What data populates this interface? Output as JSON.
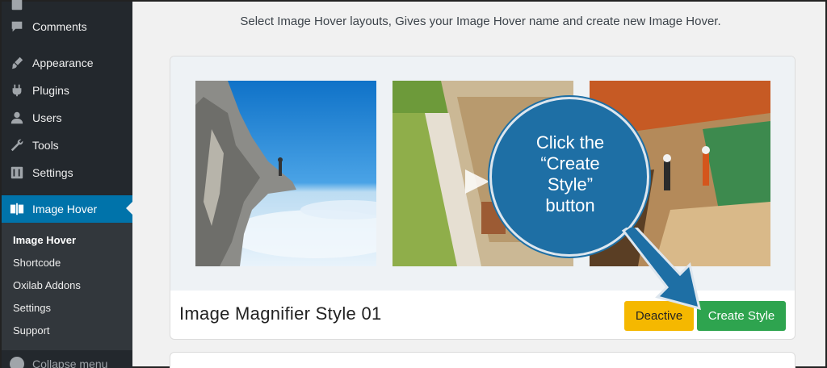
{
  "sidebar": {
    "items": [
      {
        "label": "Comments",
        "icon": "comment-icon"
      },
      {
        "label": "Appearance",
        "icon": "brush-icon"
      },
      {
        "label": "Plugins",
        "icon": "plug-icon"
      },
      {
        "label": "Users",
        "icon": "users-icon"
      },
      {
        "label": "Tools",
        "icon": "wrench-icon"
      },
      {
        "label": "Settings",
        "icon": "settings-icon"
      }
    ],
    "active": {
      "label": "Image Hover",
      "icon": "image-hover-icon"
    },
    "submenu": [
      "Image Hover",
      "Shortcode",
      "Oxilab Addons",
      "Settings",
      "Support"
    ],
    "collapse_label": "Collapse menu"
  },
  "main": {
    "intro": "Select Image Hover layouts, Gives your Image Hover name and create new Image Hover.",
    "style_card": {
      "title": "Image Magnifier Style 01",
      "deactive_label": "Deactive",
      "create_label": "Create Style"
    }
  },
  "callout": {
    "lines": [
      "Click the",
      "“Create",
      "Style”",
      "button"
    ]
  },
  "colors": {
    "sidebar_bg": "#23282d",
    "active_bg": "#0073aa",
    "deactive_btn": "#f5b800",
    "create_btn": "#2ea44f",
    "callout": "#1e6fa5"
  }
}
